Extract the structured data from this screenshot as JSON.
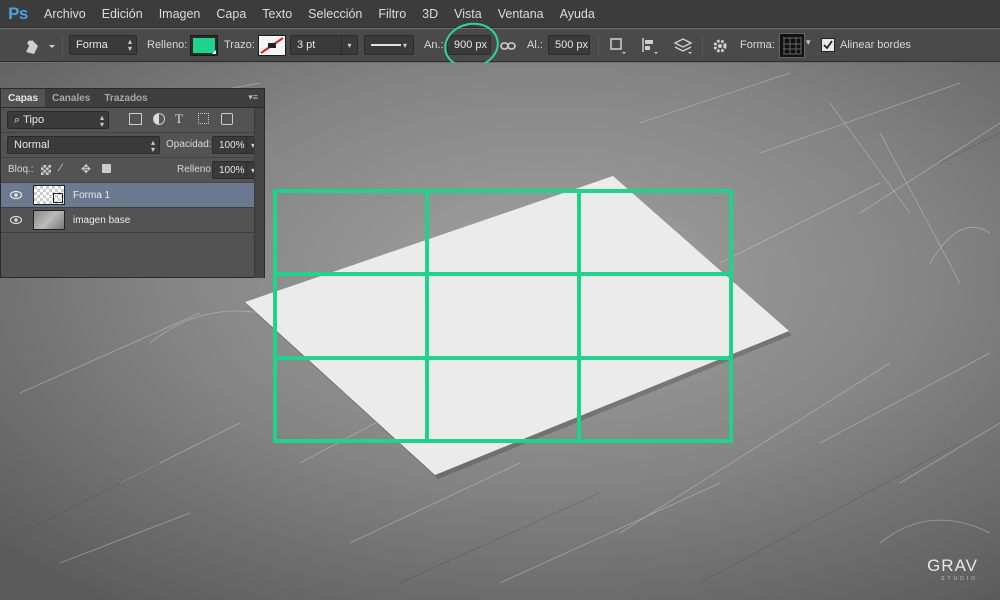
{
  "app": {
    "logo": "Ps",
    "menu": [
      "Archivo",
      "Edición",
      "Imagen",
      "Capa",
      "Texto",
      "Selección",
      "Filtro",
      "3D",
      "Vista",
      "Ventana",
      "Ayuda"
    ]
  },
  "options": {
    "tool_icon": "pen-tool-icon",
    "mode": "Forma",
    "fill_label": "Relleno:",
    "fill_color": "#1fd38d",
    "stroke_label": "Trazo:",
    "stroke_width": "3 pt",
    "width_label": "An.:",
    "width_value": "900 px",
    "link_icon": "link-icon",
    "height_label": "Al.:",
    "height_value": "500 px",
    "shape_label": "Forma:",
    "align_label": "Alinear bordes",
    "align_checked": true
  },
  "layers_panel": {
    "tabs": [
      "Capas",
      "Canales",
      "Trazados"
    ],
    "filter": "Tipo",
    "blend_mode": "Normal",
    "opacity_label": "Opacidad:",
    "opacity_value": "100%",
    "lock_label": "Bloq.:",
    "fill_label": "Relleno:",
    "fill_value": "100%",
    "layers": [
      {
        "name": "Forma 1",
        "selected": true
      },
      {
        "name": "imagen base",
        "selected": false
      }
    ]
  },
  "canvas": {
    "grid_color": "#1fd38d",
    "grid_rows": 3,
    "grid_cols": 3
  },
  "watermark": {
    "text": "GRAV",
    "subtext": "STUDIO"
  }
}
